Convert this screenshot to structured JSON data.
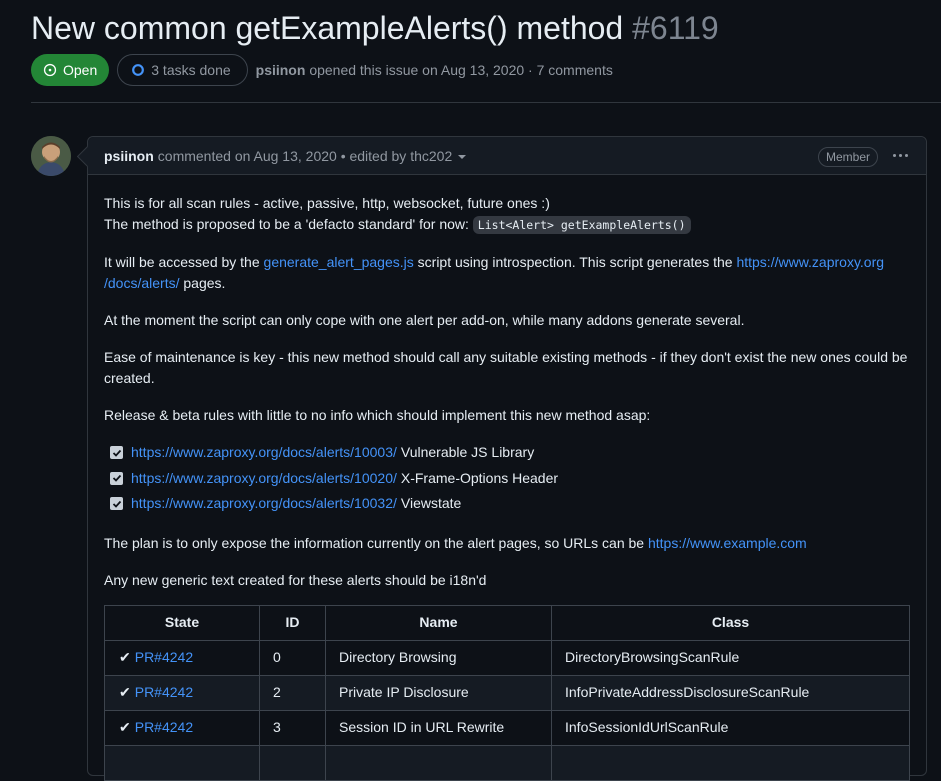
{
  "issue": {
    "title": "New common getExampleAlerts() method",
    "number": "#6119",
    "state_label": "Open",
    "tasks_label": "3 tasks done",
    "author": "psiinon",
    "meta_text": "opened this issue on Aug 13, 2020 · 7 comments"
  },
  "comment": {
    "author": "psiinon",
    "meta": "commented on Aug 13, 2020 • edited by thc202",
    "role": "Member",
    "p1_line1": "This is for all scan rules - active, passive, http, websocket, future ones :)",
    "p1_line2": "The method is proposed to be a 'defacto standard' for now:",
    "p1_code": "List<Alert> getExampleAlerts()",
    "p2_pre": "It will be accessed by the",
    "p2_link1": "generate_alert_pages.js",
    "p2_mid": "script using introspection. This script generates the",
    "p2_link2a": "https://www.zaproxy.org",
    "p2_link2b": "/docs/alerts/",
    "p2_post": "pages.",
    "p3": "At the moment the script can only cope with one alert per add-on, while many addons generate several.",
    "p4_line1": "Ease of maintenance is key - this new method should call any suitable existing methods - if they don't exist the new ones could be",
    "p4_line2": "created.",
    "p5": "Release & beta rules with little to no info which should implement this new method asap:",
    "tasks": [
      {
        "link": "https://www.zaproxy.org/docs/alerts/10003/",
        "text": "Vulnerable JS Library",
        "checked": true
      },
      {
        "link": "https://www.zaproxy.org/docs/alerts/10020/",
        "text": "X-Frame-Options Header",
        "checked": true
      },
      {
        "link": "https://www.zaproxy.org/docs/alerts/10032/",
        "text": "Viewstate",
        "checked": true
      }
    ],
    "p6_pre": "The plan is to only expose the information currently on the alert pages, so URLs can be",
    "p6_link": "https://www.example.com",
    "p7": "Any new generic text created for these alerts should be i18n'd",
    "table": {
      "headers": [
        "State",
        "ID",
        "Name",
        "Class"
      ],
      "rows": [
        {
          "check": "✔",
          "pr": "PR#4242",
          "id": "0",
          "name": "Directory Browsing",
          "class": "DirectoryBrowsingScanRule"
        },
        {
          "check": "✔",
          "pr": "PR#4242",
          "id": "2",
          "name": "Private IP Disclosure",
          "class": "InfoPrivateAddressDisclosureScanRule"
        },
        {
          "check": "✔",
          "pr": "PR#4242",
          "id": "3",
          "name": "Session ID in URL Rewrite",
          "class": "InfoSessionIdUrlScanRule"
        },
        {
          "check": "",
          "pr": "",
          "id": "",
          "name": "",
          "class": ""
        }
      ]
    }
  },
  "colors": {
    "background": "#0d1117",
    "open_badge": "#238636",
    "link": "#4493f8",
    "muted": "#9198a1"
  }
}
